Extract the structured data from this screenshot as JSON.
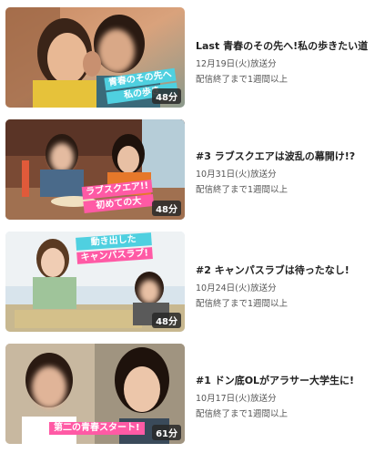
{
  "episodes": [
    {
      "title": "Last 青春のその先へ!私の歩きたい道",
      "air_date": "12月19日(火)放送分",
      "expiry": "配信終了まで1週間以上",
      "duration": "48分",
      "caption_line1": "青春のその先へ",
      "caption_line2": "私の歩き",
      "caption_color": "#4fd0e0"
    },
    {
      "title": "#3 ラブスクエアは波乱の幕開け!?",
      "air_date": "10月31日(火)放送分",
      "expiry": "配信終了まで1週間以上",
      "duration": "48分",
      "caption_line1": "ラブスクエア!!",
      "caption_line2": "初めての大",
      "caption_color": "#ff5aa5"
    },
    {
      "title": "#2 キャンパスラブは待ったなし!",
      "air_date": "10月24日(火)放送分",
      "expiry": "配信終了まで1週間以上",
      "duration": "48分",
      "caption_line1": "動き出した",
      "caption_line2": "キャンパスラブ!",
      "caption_color": "#ff5aa5"
    },
    {
      "title": "#1 ドン底OLがアラサー大学生に!",
      "air_date": "10月17日(火)放送分",
      "expiry": "配信終了まで1週間以上",
      "duration": "61分",
      "caption_line1": "第二の青春スタート!",
      "caption_line2": "",
      "caption_color": "#ff5aa5"
    }
  ]
}
